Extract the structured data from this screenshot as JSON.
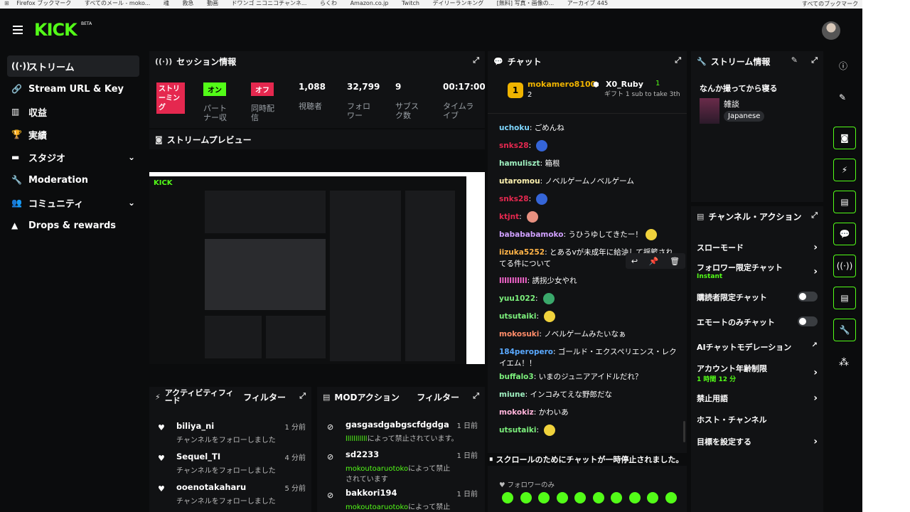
{
  "bookmarks": [
    "Firefox ブックマーク",
    "すべてのメール - moko...",
    "魂",
    "救急",
    "動画",
    "ドワンゴ ニコニコチャンネ...",
    "らくわ",
    "Amazon.co.jp",
    "Twitch",
    "デイリーランキング",
    "[無料] 写真・画像の...",
    "アーカイブ 445",
    "すべてのブックマーク"
  ],
  "brand": {
    "logo": "KICK",
    "badge": "BETA",
    "accent": "#53fc18"
  },
  "sidebar": [
    {
      "label": "ストリーム",
      "icon": "broadcast-icon"
    },
    {
      "label": "Stream URL & Key",
      "icon": "link-icon"
    },
    {
      "label": "収益",
      "icon": "chart-icon"
    },
    {
      "label": "実績",
      "icon": "trophy-icon"
    },
    {
      "label": "スタジオ",
      "icon": "studio-icon"
    },
    {
      "label": "Moderation",
      "icon": "wrench-icon"
    },
    {
      "label": "コミュニティ",
      "icon": "users-icon"
    },
    {
      "label": "Drops & rewards",
      "icon": "drops-icon"
    }
  ],
  "session": {
    "title": "セッション情報",
    "live": "ストリーミング",
    "partner_state": "オン",
    "partner_label": "パートナー収",
    "simul_state": "オフ",
    "simul_label": "同時配信",
    "viewers": "1,088",
    "viewers_label": "視聴者",
    "followers": "32,799",
    "followers_label": "フォロワー",
    "subs": "9",
    "subs_label": "サブスク数",
    "time": "00:17:00",
    "time_label": "タイムライブ"
  },
  "preview": {
    "title": "ストリームプレビュー"
  },
  "activity": {
    "title": "アクティビティフィード",
    "filter": "フィルター",
    "rows": [
      {
        "user": "biliya_ni",
        "text": "チャンネルをフォローしました",
        "time": "1 分前"
      },
      {
        "user": "Sequel_TI",
        "text": "チャンネルをフォローしました",
        "time": "4 分前"
      },
      {
        "user": "ooenotakaharu",
        "text": "チャンネルをフォローしました",
        "time": "5 分前"
      }
    ]
  },
  "mod": {
    "title": "MODアクション",
    "filter": "フィルター",
    "rows": [
      {
        "user": "gasgasdgabgscfdgdga",
        "by": "lllllllllll",
        "text": "によって禁止されています。",
        "time": "1 日前"
      },
      {
        "user": "sd2233",
        "by": "mokoutoaruotoko",
        "text": "によって禁止されています",
        "time": "1 日前"
      },
      {
        "user": "bakkori194",
        "by": "mokoutoaruotoko",
        "text": "によって禁止されています",
        "time": "1 日前"
      }
    ]
  },
  "chat": {
    "title": "チャット",
    "top": {
      "rank1": "1",
      "user1": "mokamero8100",
      "count1": "2",
      "user2": "X0_Ruby",
      "count2": "1",
      "gift": "ギフト 1 sub to take 3th"
    },
    "messages": [
      {
        "user": "uchoku",
        "color": "#7fd7ff",
        "text": "ごめんね"
      },
      {
        "user": "snks28",
        "color": "#e5284f",
        "text": ""
      },
      {
        "user": "hamuliszt",
        "color": "#9ff0c0",
        "text": "箱根"
      },
      {
        "user": "utaromou",
        "color": "#fff3b0",
        "text": "ノベルゲームノベルゲーム"
      },
      {
        "user": "snks28",
        "color": "#e5284f",
        "text": ""
      },
      {
        "user": "ktjnt",
        "color": "#e5284f",
        "text": ""
      },
      {
        "user": "babababamoko",
        "color": "#d0a0ff",
        "text": "うひうゆしてきたー！"
      },
      {
        "user": "iizuka5252",
        "color": "#ffb347",
        "text": "とあるvが未成年に給油して揺籃されてる件について"
      },
      {
        "user": "lllllllllll",
        "color": "#ff6ad5",
        "text": "誘拐少女やれ"
      },
      {
        "user": "yuu1022",
        "color": "#7cf07c",
        "text": ""
      },
      {
        "user": "utsutaiki",
        "color": "#7cf07c",
        "text": ""
      },
      {
        "user": "mokosuki",
        "color": "#ff8c69",
        "text": "ノベルゲームみたいなぁ"
      },
      {
        "user": "184peropero",
        "color": "#5aa9ff",
        "text": "ゴールド・エクスペリエンス・レクイエム！！"
      },
      {
        "user": "buffalo3",
        "color": "#7cf07c",
        "text": "いまのジュニアアイドルだれ？"
      },
      {
        "user": "miune",
        "color": "#9ff0c0",
        "text": "インコみてえな野郎だな"
      },
      {
        "user": "mokokiz",
        "color": "#ffb3d9",
        "text": "かわいあ"
      },
      {
        "user": "utsutaiki",
        "color": "#7cf07c",
        "text": ""
      }
    ],
    "paused": "スクロールのためにチャットが一時停止されました。",
    "followers_only": "フォロワーのみ"
  },
  "info": {
    "title": "ストリーム情報",
    "stream_title": "なんか撮ってから寝る",
    "category": "雑談",
    "language": "Japanese"
  },
  "actions": {
    "title": "チャンネル・アクション",
    "items": [
      {
        "label": "スローモード",
        "sub": "",
        "type": "arrow"
      },
      {
        "label": "フォロワー限定チャット",
        "sub": "Instant",
        "type": "arrow"
      },
      {
        "label": "購読者限定チャット",
        "sub": "",
        "type": "toggle"
      },
      {
        "label": "エモートのみチャット",
        "sub": "",
        "type": "toggle"
      },
      {
        "label": "AIチャットモデレーション",
        "sub": "",
        "type": "ext"
      },
      {
        "label": "アカウント年齢制限",
        "sub": "1 時間 12 分",
        "type": "arrow"
      },
      {
        "label": "禁止用語",
        "sub": "",
        "type": "arrow"
      },
      {
        "label": "ホスト・チャンネル",
        "sub": "",
        "type": "none"
      },
      {
        "label": "目標を設定する",
        "sub": "",
        "type": "arrow"
      }
    ]
  }
}
